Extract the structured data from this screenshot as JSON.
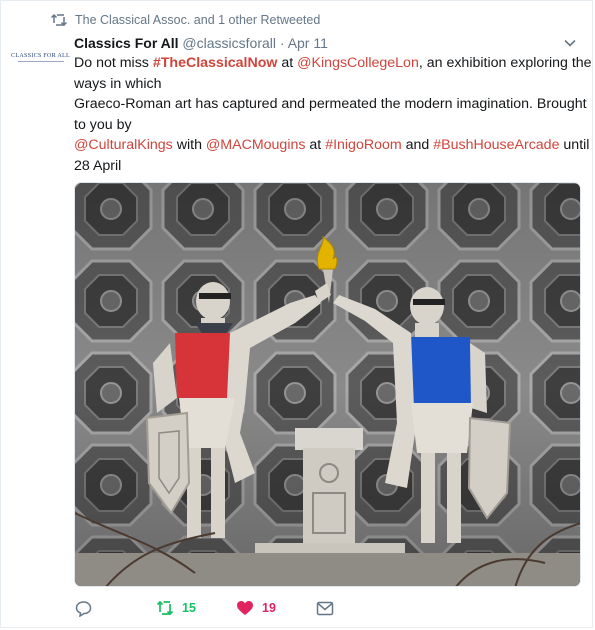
{
  "context": {
    "icon": "retweet-icon",
    "text": "The Classical Assoc. and 1 other Retweeted"
  },
  "avatar": {
    "label": "CLASSICS FOR ALL"
  },
  "tweet": {
    "name": "Classics For All",
    "handle": "@classicsforall",
    "separator": "·",
    "date": "Apr 11",
    "line1_a": "Do not miss ",
    "line1_hashtag": "#TheClassicalNow",
    "line1_b": " at ",
    "line1_mention": "@KingsCollegeLon",
    "line1_c": ", an exhibition exploring the",
    "line2": "ways in which",
    "line3": "Graeco-Roman art has captured and permeated the modern imagination. Brought",
    "line4": "to you by",
    "line5_mention1": "@CulturalKings",
    "line5_a": " with ",
    "line5_mention2": "@MACMougins",
    "line5_b": " at ",
    "line5_hashtag1": "#InigoRoom",
    "line5_c": " and ",
    "line5_hashtag2": "#BushHouseArcade",
    "line5_d": " until",
    "line6": "28 April"
  },
  "media": {
    "description_icon": "photo"
  },
  "actions": {
    "reply": {
      "icon": "reply-icon",
      "count": ""
    },
    "retweet": {
      "icon": "retweet-icon",
      "count": "15",
      "color": "#17bf63"
    },
    "like": {
      "icon": "heart-icon",
      "count": "19",
      "color": "#e0245e"
    },
    "dm": {
      "icon": "envelope-icon",
      "count": ""
    }
  },
  "colors": {
    "link": "#d0443b",
    "muted": "#657786",
    "text": "#14171a"
  }
}
